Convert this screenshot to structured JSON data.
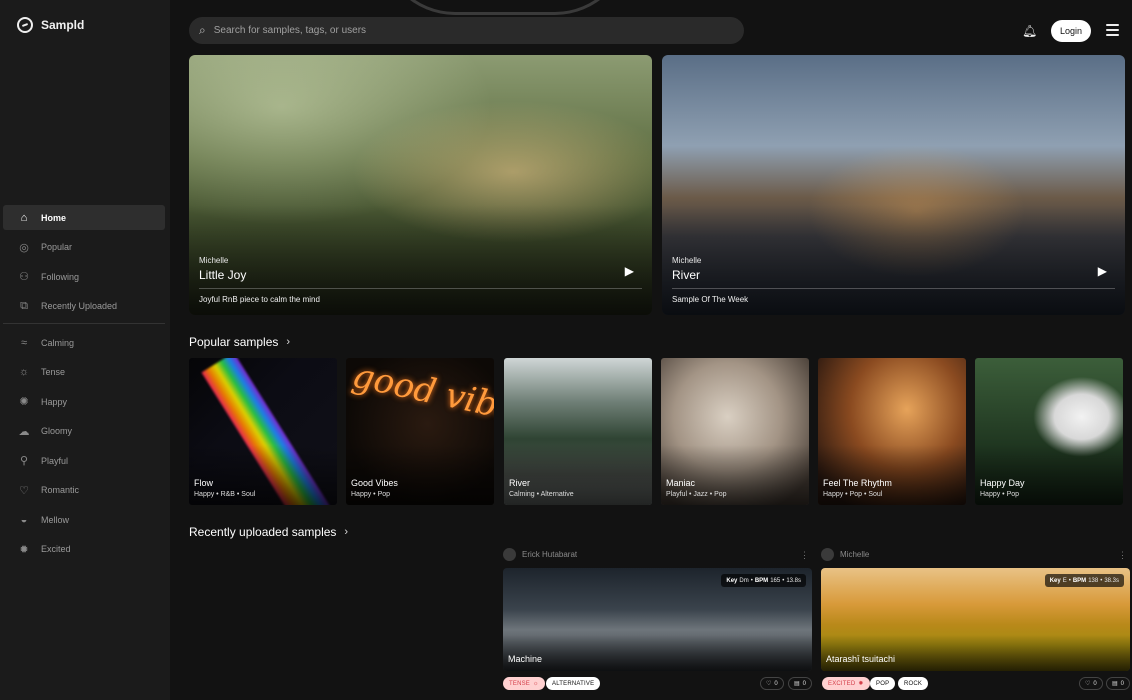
{
  "app": {
    "name": "Sampld"
  },
  "search": {
    "placeholder": "Search for samples, tags, or users",
    "icon": "search-icon"
  },
  "header": {
    "login_label": "Login"
  },
  "sidebar": {
    "items": [
      {
        "label": "Home",
        "icon": "home-icon",
        "active": true
      },
      {
        "label": "Popular",
        "icon": "popular-icon"
      },
      {
        "label": "Following",
        "icon": "following-icon"
      },
      {
        "label": "Recently Uploaded",
        "icon": "recent-upload-icon"
      }
    ],
    "moods": [
      {
        "label": "Calming",
        "icon": "calming-icon"
      },
      {
        "label": "Tense",
        "icon": "tense-icon"
      },
      {
        "label": "Happy",
        "icon": "happy-icon"
      },
      {
        "label": "Gloomy",
        "icon": "gloomy-icon"
      },
      {
        "label": "Playful",
        "icon": "playful-icon"
      },
      {
        "label": "Romantic",
        "icon": "romantic-icon"
      },
      {
        "label": "Mellow",
        "icon": "mellow-icon"
      },
      {
        "label": "Excited",
        "icon": "excited-icon"
      }
    ]
  },
  "hero": [
    {
      "author": "Michelle",
      "title": "Little Joy",
      "description": "Joyful RnB piece to calm the mind"
    },
    {
      "author": "Michelle",
      "title": "River",
      "description": "Sample Of The Week"
    }
  ],
  "popular": {
    "title": "Popular samples",
    "items": [
      {
        "title": "Flow",
        "tags": "Happy • R&B • Soul"
      },
      {
        "title": "Good Vibes",
        "tags": "Happy • Pop",
        "art_text": "good vibes only"
      },
      {
        "title": "River",
        "tags": "Calming • Alternative"
      },
      {
        "title": "Maniac",
        "tags": "Playful • Jazz • Pop"
      },
      {
        "title": "Feel The Rhythm",
        "tags": "Happy • Pop • Soul"
      },
      {
        "title": "Happy Day",
        "tags": "Happy • Pop"
      }
    ]
  },
  "recent": {
    "title": "Recently uploaded samples",
    "items": [
      {
        "author": "Erick Hutabarat",
        "title": "Machine",
        "meta_key_label": "Key",
        "meta_key": "Dm",
        "meta_bpm_label": "BPM",
        "meta_bpm": "165",
        "meta_length": "13.8s",
        "mood": "TENSE",
        "genres": [
          "ALTERNATIVE"
        ],
        "likes": "0",
        "comments": "0"
      },
      {
        "author": "Michelle",
        "title": "Atarashī tsuitachi",
        "meta_key_label": "Key",
        "meta_key": "E",
        "meta_bpm_label": "BPM",
        "meta_bpm": "138",
        "meta_length": "38.3s",
        "mood": "EXCITED",
        "genres": [
          "POP",
          "ROCK"
        ],
        "likes": "0",
        "comments": "0"
      }
    ]
  },
  "colors": {
    "background": "#121212",
    "sidebar": "#1b1b1b",
    "accent_mood_bg": "#ffd1d1",
    "accent_mood_text": "#d4404a"
  }
}
